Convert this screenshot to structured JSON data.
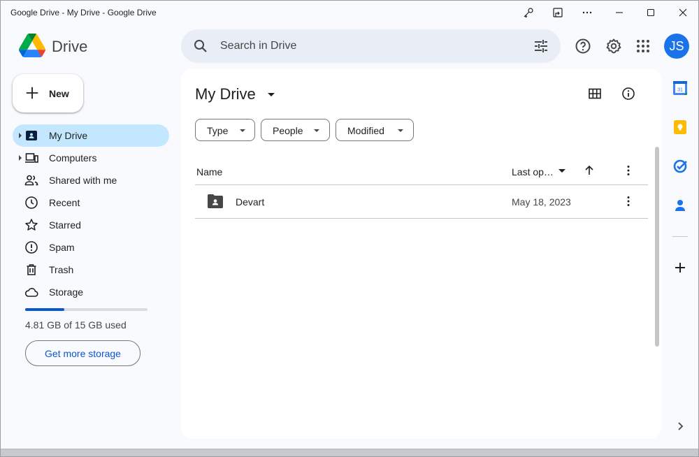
{
  "window": {
    "title": "Google Drive - My Drive - Google Drive"
  },
  "header": {
    "app_name": "Drive",
    "search_placeholder": "Search in Drive",
    "avatar_initials": "JS"
  },
  "sidebar": {
    "new_label": "New",
    "items": [
      {
        "label": "My Drive",
        "active": true,
        "expandable": true,
        "icon": "my-drive-icon"
      },
      {
        "label": "Computers",
        "active": false,
        "expandable": true,
        "icon": "computers-icon"
      },
      {
        "label": "Shared with me",
        "active": false,
        "expandable": false,
        "icon": "people-icon"
      },
      {
        "label": "Recent",
        "active": false,
        "expandable": false,
        "icon": "clock-icon"
      },
      {
        "label": "Starred",
        "active": false,
        "expandable": false,
        "icon": "star-icon"
      },
      {
        "label": "Spam",
        "active": false,
        "expandable": false,
        "icon": "spam-icon"
      },
      {
        "label": "Trash",
        "active": false,
        "expandable": false,
        "icon": "trash-icon"
      },
      {
        "label": "Storage",
        "active": false,
        "expandable": false,
        "icon": "cloud-icon"
      }
    ],
    "storage_used_fraction": 0.32,
    "storage_text": "4.81 GB of 15 GB used",
    "get_storage_label": "Get more storage"
  },
  "main": {
    "title": "My Drive",
    "filters": [
      "Type",
      "People",
      "Modified"
    ],
    "columns": {
      "name": "Name",
      "last_opened": "Last op…"
    },
    "files": [
      {
        "name": "Devart",
        "date": "May 18, 2023",
        "type": "shared-folder"
      }
    ]
  },
  "side_panel": {
    "apps": [
      "calendar-icon",
      "keep-icon",
      "tasks-icon",
      "contacts-icon"
    ],
    "calendar_day": "31"
  },
  "colors": {
    "accent": "#0b57d0",
    "active_nav": "#c2e7ff",
    "search_bg": "#e9eef6",
    "avatar": "#1a73e8"
  }
}
